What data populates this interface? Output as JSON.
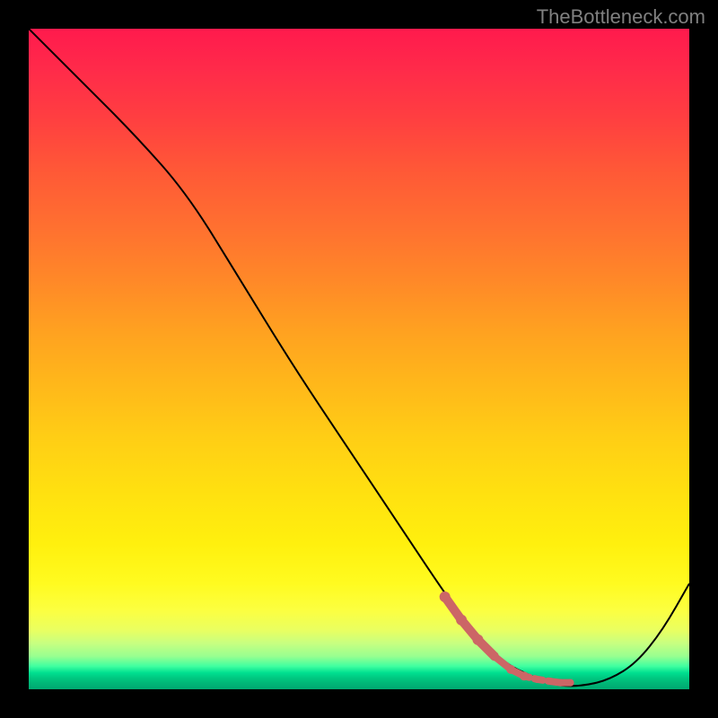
{
  "watermark": "TheBottleneck.com",
  "chart_data": {
    "type": "line",
    "title": "",
    "xlabel": "",
    "ylabel": "",
    "xlim": [
      0,
      100
    ],
    "ylim": [
      0,
      100
    ],
    "grid": false,
    "legend": false,
    "curve": {
      "x": [
        0,
        8,
        16,
        24,
        32,
        40,
        48,
        56,
        64,
        68,
        72,
        76,
        80,
        84,
        88,
        92,
        96,
        100
      ],
      "y": [
        100,
        92,
        84,
        75,
        62,
        49,
        37,
        25,
        13,
        8,
        4,
        2,
        0.5,
        0.5,
        1.5,
        4,
        9,
        16
      ]
    },
    "highlight_segment": {
      "color": "#cc6666",
      "points_x": [
        63,
        65.5,
        68,
        70.5,
        73,
        75,
        77,
        79,
        80.5,
        82
      ],
      "points_y": [
        14,
        10.5,
        7.5,
        5,
        3,
        2,
        1.5,
        1.2,
        1,
        1
      ]
    },
    "gradient_stops": [
      {
        "pos": 0,
        "color": "#ff1a4d"
      },
      {
        "pos": 0.5,
        "color": "#ffb81a"
      },
      {
        "pos": 0.85,
        "color": "#fffb20"
      },
      {
        "pos": 0.96,
        "color": "#40ffa0"
      },
      {
        "pos": 1.0,
        "color": "#00a870"
      }
    ]
  }
}
